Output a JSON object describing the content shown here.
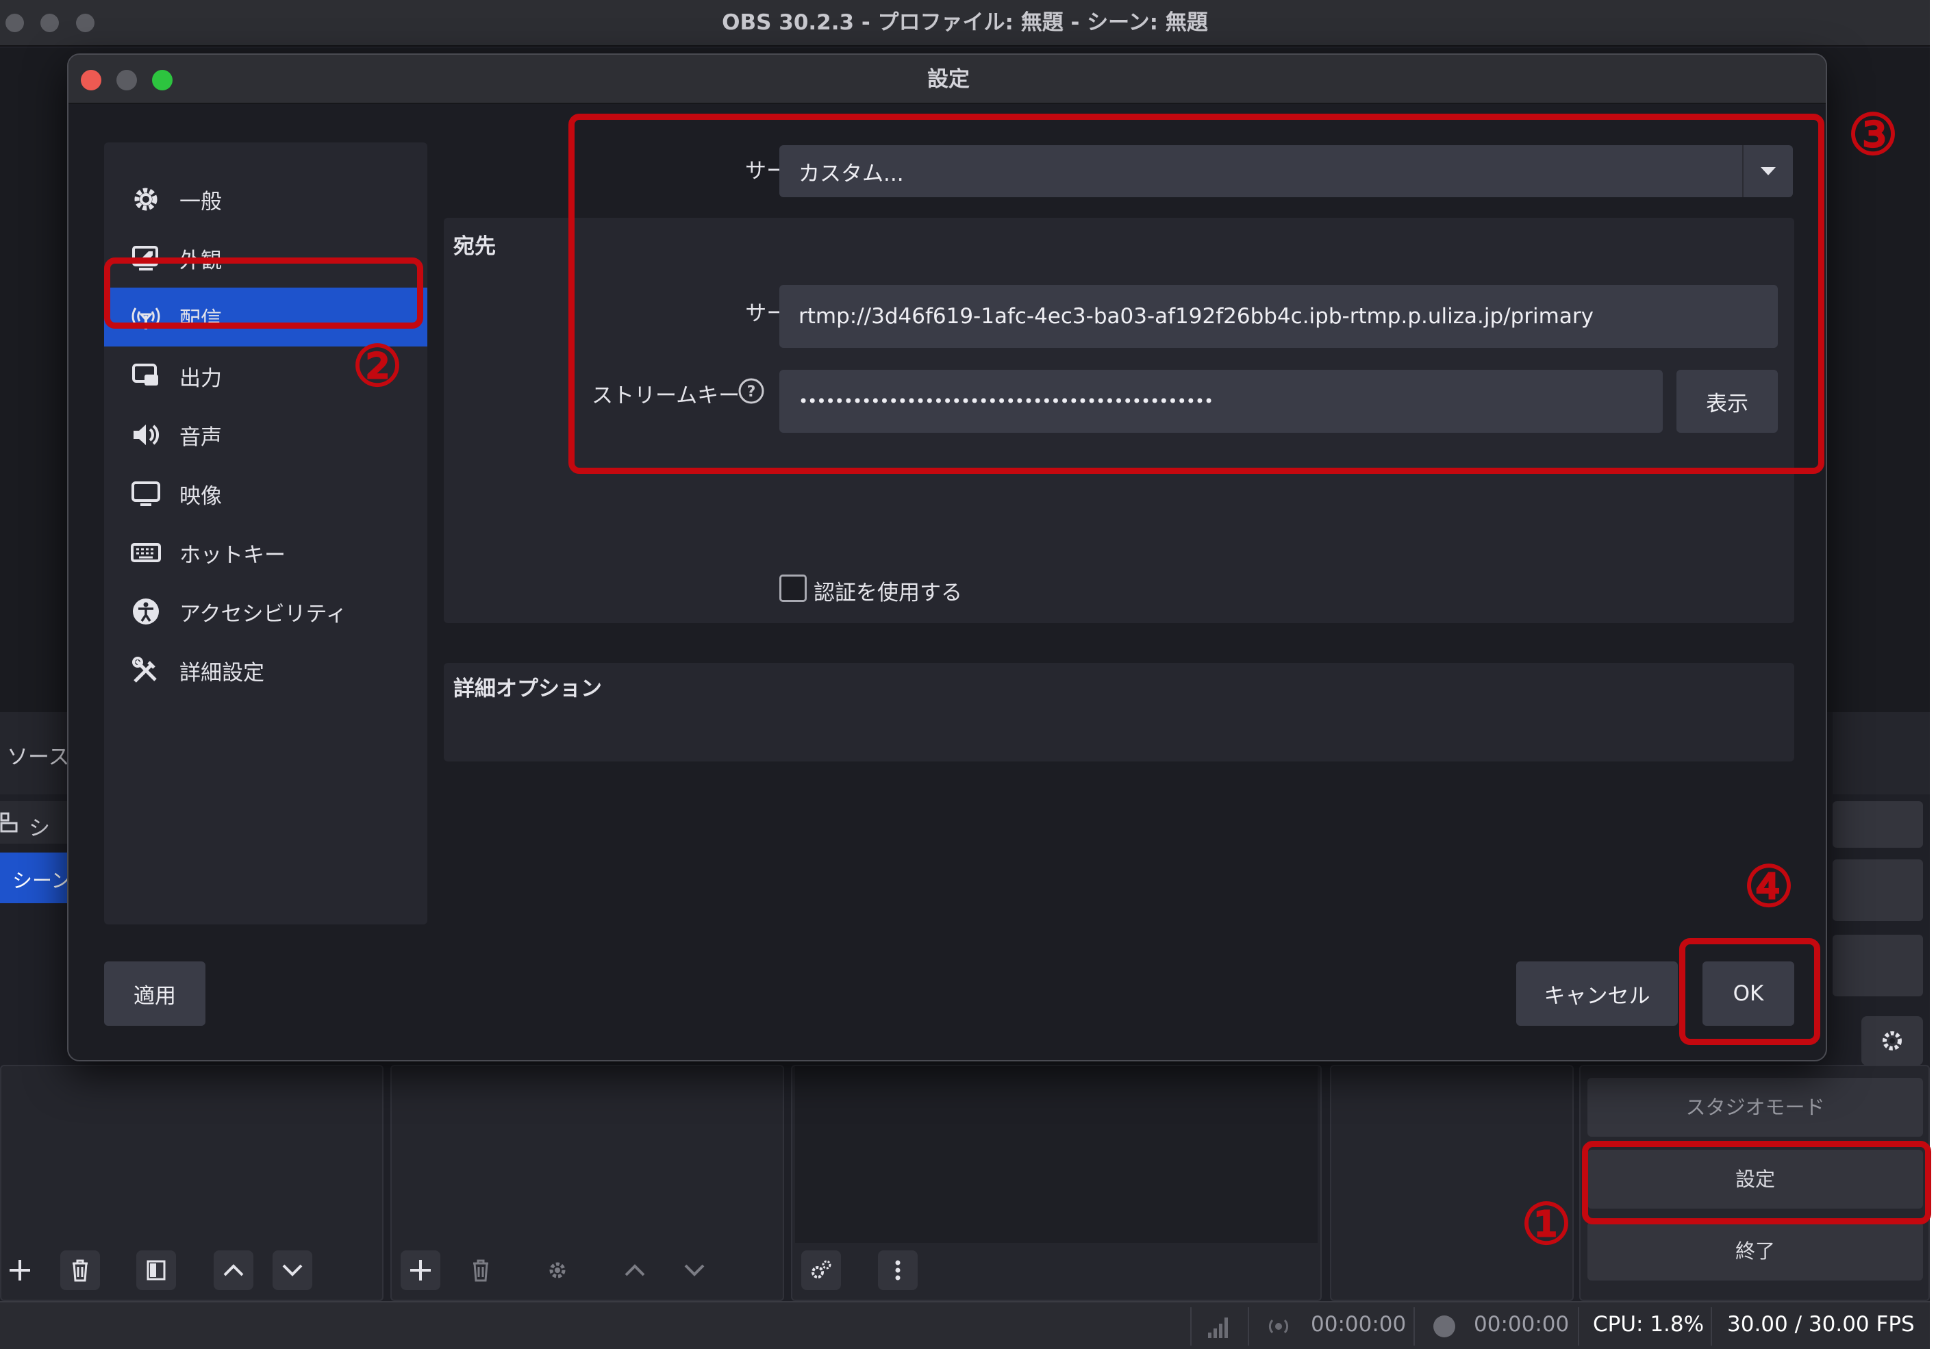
{
  "main": {
    "title": "OBS 30.2.3 - プロファイル: 無題 - シーン: 無題",
    "sources_tab": "ソース",
    "scene_list_header": "シー",
    "scene_list_item": "シーン"
  },
  "controls": {
    "studio_mode": "スタジオモード",
    "settings": "設定",
    "exit": "終了"
  },
  "status": {
    "stream_time": "00:00:00",
    "rec_time": "00:00:00",
    "cpu": "CPU: 1.8%",
    "fps": "30.00 / 30.00 FPS"
  },
  "dialog": {
    "title": "設定",
    "sidebar": {
      "items": [
        {
          "label": "一般",
          "icon": "gear-icon"
        },
        {
          "label": "外観",
          "icon": "appearance-icon"
        },
        {
          "label": "配信",
          "icon": "antenna-icon"
        },
        {
          "label": "出力",
          "icon": "output-icon"
        },
        {
          "label": "音声",
          "icon": "speaker-icon"
        },
        {
          "label": "映像",
          "icon": "monitor-icon"
        },
        {
          "label": "ホットキー",
          "icon": "keyboard-icon"
        },
        {
          "label": "アクセシビリティ",
          "icon": "accessibility-icon"
        },
        {
          "label": "詳細設定",
          "icon": "tools-icon"
        }
      ],
      "active_index": 2
    },
    "service_label": "サービス",
    "service_value": "カスタム...",
    "destination_title": "宛先",
    "server_label": "サーバー",
    "server_value": "rtmp://3d46f619-1afc-4ec3-ba03-af192f26bb4c.ipb-rtmp.p.uliza.jp/primary",
    "stream_key_label": "ストリームキー",
    "stream_key_value": "••••••••••••••••••••••••••••••••••••••••••••••",
    "show_button": "表示",
    "use_auth_label": "認証を使用する",
    "use_auth_checked": false,
    "advanced_title": "詳細オプション",
    "apply_button": "適用",
    "cancel_button": "キャンセル",
    "ok_button": "OK"
  },
  "annotations": {
    "step1": "①",
    "step2": "②",
    "step3": "③",
    "step4": "④",
    "color": "#c4080f"
  }
}
